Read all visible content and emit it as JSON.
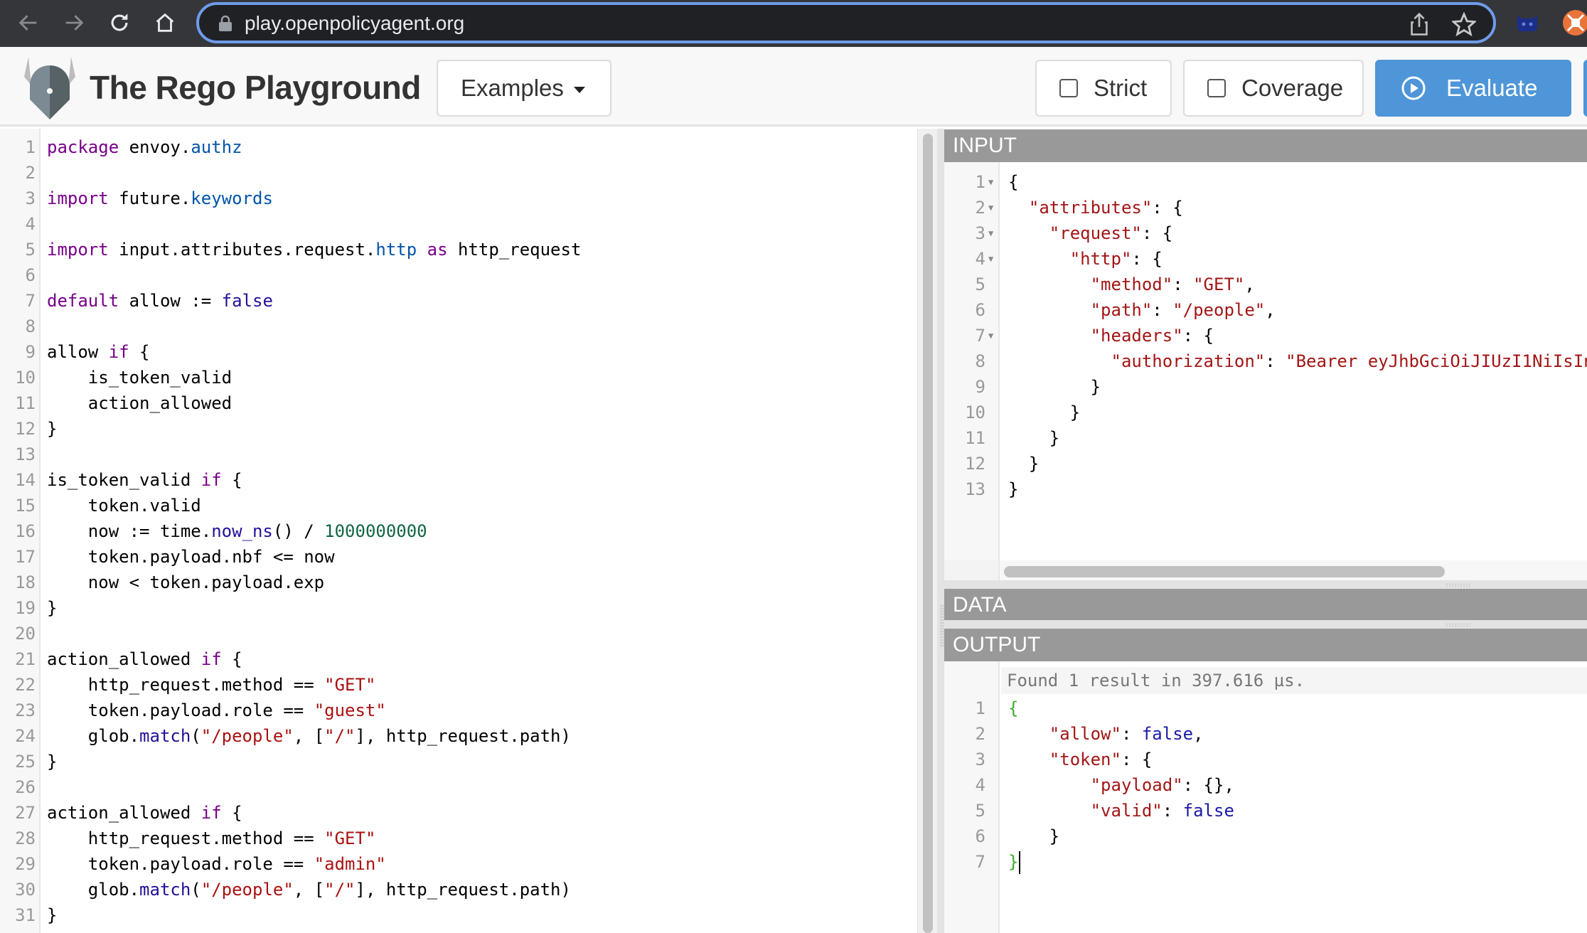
{
  "browser": {
    "url": "play.openpolicyagent.org",
    "icons": [
      "back-arrow-icon",
      "forward-arrow-icon",
      "reload-icon",
      "home-icon",
      "lock-icon",
      "share-icon",
      "bookmark-star-icon",
      "octocat-extension-icon",
      "orange-extension-icon"
    ]
  },
  "header": {
    "title": "The Rego Playground",
    "examples_label": "Examples",
    "strict_label": "Strict",
    "strict_checked": false,
    "coverage_label": "Coverage",
    "coverage_checked": false,
    "evaluate_label": "Evaluate",
    "colors": {
      "evaluate_bg": "#4f96d8",
      "panel_header_bg": "#999999"
    }
  },
  "policy_editor": {
    "lines": [
      [
        [
          "k",
          "package"
        ],
        [
          "t",
          " envoy."
        ],
        [
          "p",
          "authz"
        ]
      ],
      [],
      [
        [
          "k",
          "import"
        ],
        [
          "t",
          " future."
        ],
        [
          "p",
          "keywords"
        ]
      ],
      [],
      [
        [
          "k",
          "import"
        ],
        [
          "t",
          " input.attributes.request."
        ],
        [
          "p",
          "http"
        ],
        [
          "t",
          " "
        ],
        [
          "k",
          "as"
        ],
        [
          "t",
          " http_request"
        ]
      ],
      [],
      [
        [
          "k",
          "default"
        ],
        [
          "t",
          " allow := "
        ],
        [
          "a",
          "false"
        ]
      ],
      [],
      [
        [
          "t",
          "allow "
        ],
        [
          "k",
          "if"
        ],
        [
          "t",
          " {"
        ]
      ],
      [
        [
          "t",
          "    is_token_valid"
        ]
      ],
      [
        [
          "t",
          "    action_allowed"
        ]
      ],
      [
        [
          "t",
          "}"
        ]
      ],
      [],
      [
        [
          "t",
          "is_token_valid "
        ],
        [
          "k",
          "if"
        ],
        [
          "t",
          " {"
        ]
      ],
      [
        [
          "t",
          "    token.valid"
        ]
      ],
      [
        [
          "t",
          "    now := time."
        ],
        [
          "a",
          "now_ns"
        ],
        [
          "t",
          "() / "
        ],
        [
          "n",
          "1000000000"
        ]
      ],
      [
        [
          "t",
          "    token.payload.nbf <= now"
        ]
      ],
      [
        [
          "t",
          "    now < token.payload.exp"
        ]
      ],
      [
        [
          "t",
          "}"
        ]
      ],
      [],
      [
        [
          "t",
          "action_allowed "
        ],
        [
          "k",
          "if"
        ],
        [
          "t",
          " {"
        ]
      ],
      [
        [
          "t",
          "    http_request.method == "
        ],
        [
          "s",
          "\"GET\""
        ]
      ],
      [
        [
          "t",
          "    token.payload.role == "
        ],
        [
          "s",
          "\"guest\""
        ]
      ],
      [
        [
          "t",
          "    glob."
        ],
        [
          "a",
          "match"
        ],
        [
          "t",
          "("
        ],
        [
          "s",
          "\"/people\""
        ],
        [
          "t",
          ", ["
        ],
        [
          "s",
          "\"/\""
        ],
        [
          "t",
          "], http_request.path)"
        ]
      ],
      [
        [
          "t",
          "}"
        ]
      ],
      [],
      [
        [
          "t",
          "action_allowed "
        ],
        [
          "k",
          "if"
        ],
        [
          "t",
          " {"
        ]
      ],
      [
        [
          "t",
          "    http_request.method == "
        ],
        [
          "s",
          "\"GET\""
        ]
      ],
      [
        [
          "t",
          "    token.payload.role == "
        ],
        [
          "s",
          "\"admin\""
        ]
      ],
      [
        [
          "t",
          "    glob."
        ],
        [
          "a",
          "match"
        ],
        [
          "t",
          "("
        ],
        [
          "s",
          "\"/people\""
        ],
        [
          "t",
          ", ["
        ],
        [
          "s",
          "\"/\""
        ],
        [
          "t",
          "], http_request.path)"
        ]
      ],
      [
        [
          "t",
          "}"
        ]
      ]
    ]
  },
  "input_panel": {
    "title": "INPUT",
    "lines": [
      {
        "fold": true,
        "tokens": [
          [
            "t",
            "{"
          ]
        ]
      },
      {
        "fold": true,
        "tokens": [
          [
            "t",
            "  "
          ],
          [
            "jk",
            "\"attributes\""
          ],
          [
            "t",
            ": {"
          ]
        ]
      },
      {
        "fold": true,
        "tokens": [
          [
            "t",
            "    "
          ],
          [
            "jk",
            "\"request\""
          ],
          [
            "t",
            ": {"
          ]
        ]
      },
      {
        "fold": true,
        "tokens": [
          [
            "t",
            "      "
          ],
          [
            "jk",
            "\"http\""
          ],
          [
            "t",
            ": {"
          ]
        ]
      },
      {
        "fold": false,
        "tokens": [
          [
            "t",
            "        "
          ],
          [
            "jk",
            "\"method\""
          ],
          [
            "t",
            ": "
          ],
          [
            "jk",
            "\"GET\""
          ],
          [
            "t",
            ","
          ]
        ]
      },
      {
        "fold": false,
        "tokens": [
          [
            "t",
            "        "
          ],
          [
            "jk",
            "\"path\""
          ],
          [
            "t",
            ": "
          ],
          [
            "jk",
            "\"/people\""
          ],
          [
            "t",
            ","
          ]
        ]
      },
      {
        "fold": true,
        "tokens": [
          [
            "t",
            "        "
          ],
          [
            "jk",
            "\"headers\""
          ],
          [
            "t",
            ": {"
          ]
        ]
      },
      {
        "fold": false,
        "tokens": [
          [
            "t",
            "          "
          ],
          [
            "jk",
            "\"authorization\""
          ],
          [
            "t",
            ": "
          ],
          [
            "jk",
            "\"Bearer eyJhbGciOiJIUzI1NiIsIn"
          ]
        ]
      },
      {
        "fold": false,
        "tokens": [
          [
            "t",
            "        }"
          ]
        ]
      },
      {
        "fold": false,
        "tokens": [
          [
            "t",
            "      }"
          ]
        ]
      },
      {
        "fold": false,
        "tokens": [
          [
            "t",
            "    }"
          ]
        ]
      },
      {
        "fold": false,
        "tokens": [
          [
            "t",
            "  }"
          ]
        ]
      },
      {
        "fold": false,
        "tokens": [
          [
            "t",
            "}"
          ]
        ]
      }
    ]
  },
  "data_panel": {
    "title": "DATA"
  },
  "output_panel": {
    "title": "OUTPUT",
    "status": "Found 1 result in 397.616 µs.",
    "lines": [
      [
        [
          "jg",
          "{"
        ]
      ],
      [
        [
          "t",
          "    "
        ],
        [
          "jk",
          "\"allow\""
        ],
        [
          "t",
          ": "
        ],
        [
          "jb",
          "false"
        ],
        [
          "t",
          ","
        ]
      ],
      [
        [
          "t",
          "    "
        ],
        [
          "jk",
          "\"token\""
        ],
        [
          "t",
          ": {"
        ]
      ],
      [
        [
          "t",
          "        "
        ],
        [
          "jk",
          "\"payload\""
        ],
        [
          "t",
          ": {},"
        ]
      ],
      [
        [
          "t",
          "        "
        ],
        [
          "jk",
          "\"valid\""
        ],
        [
          "t",
          ": "
        ],
        [
          "jb",
          "false"
        ]
      ],
      [
        [
          "t",
          "    }"
        ]
      ],
      [
        [
          "jg",
          "}"
        ]
      ]
    ]
  }
}
